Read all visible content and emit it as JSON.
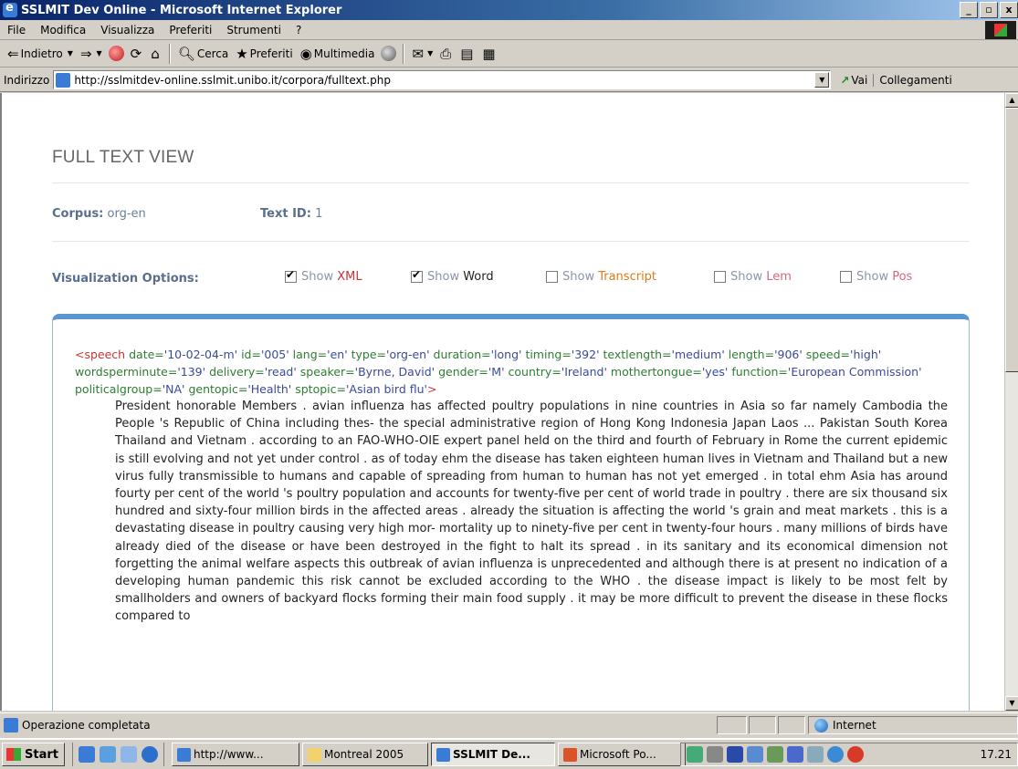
{
  "window": {
    "title": "SSLMIT Dev Online - Microsoft Internet Explorer",
    "min": "_",
    "max": "▫",
    "close": "x"
  },
  "menu": [
    "File",
    "Modifica",
    "Visualizza",
    "Preferiti",
    "Strumenti",
    "?"
  ],
  "toolbar": {
    "back": "Indietro",
    "search": "Cerca",
    "favorites": "Preferiti",
    "media": "Multimedia"
  },
  "address": {
    "label": "Indirizzo",
    "url": "http://sslmitdev-online.sslmit.unibo.it/corpora/fulltext.php",
    "go": "Vai",
    "links": "Collegamenti"
  },
  "page": {
    "title": "FULL TEXT VIEW",
    "corpus_label": "Corpus:",
    "corpus_value": "org-en",
    "textid_label": "Text ID:",
    "textid_value": "1",
    "vis_label": "Visualization Options:",
    "options": [
      {
        "prefix": "Show",
        "name": "XML",
        "checked": true,
        "color": "#cc3333"
      },
      {
        "prefix": "Show",
        "name": "Word",
        "checked": true,
        "color": "#222222"
      },
      {
        "prefix": "Show",
        "name": "Transcript",
        "checked": false,
        "color": "#e07a1a"
      },
      {
        "prefix": "Show",
        "name": "Lem",
        "checked": false,
        "color": "#d9667a"
      },
      {
        "prefix": "Show",
        "name": "Pos",
        "checked": false,
        "color": "#d9667a"
      }
    ],
    "xml_open": "<speech",
    "xml_attrs": [
      [
        "date",
        "'10-02-04-m'"
      ],
      [
        "id",
        "'005'"
      ],
      [
        "lang",
        "'en'"
      ],
      [
        "type",
        "'org-en'"
      ],
      [
        "duration",
        "'long'"
      ],
      [
        "timing",
        "'392'"
      ],
      [
        "textlength",
        "'medium'"
      ],
      [
        "length",
        "'906'"
      ],
      [
        "speed",
        "'high'"
      ],
      [
        "wordsperminute",
        "'139'"
      ],
      [
        "delivery",
        "'read'"
      ],
      [
        "speaker",
        "'Byrne, David'"
      ],
      [
        "gender",
        "'M'"
      ],
      [
        "country",
        "'Ireland'"
      ],
      [
        "mothertongue",
        "'yes'"
      ],
      [
        "function",
        "'European Commission'"
      ],
      [
        "politicalgroup",
        "'NA'"
      ],
      [
        "gentopic",
        "'Health'"
      ],
      [
        "sptopic",
        "'Asian bird flu'"
      ]
    ],
    "xml_close": ">",
    "text": "President honorable Members . avian influenza has affected poultry populations in nine countries in Asia so far namely Cambodia the People 's Republic of China including thes- the special administrative region of Hong Kong Indonesia Japan Laos ... Pakistan South Korea Thailand and Vietnam . according to an FAO-WHO-OIE expert panel held on the third and fourth of February in Rome the current epidemic is still evolving and not yet under control . as of today ehm the disease has taken eighteen human lives in Vietnam and Thailand but a new virus fully transmissible to humans and capable of spreading from human to human has not yet emerged . in total ehm Asia has around fourty per cent of the world 's poultry population and accounts for twenty-five per cent of world trade in poultry . there are six thousand six hundred and sixty-four million birds in the affected areas . already the situation is affecting the world 's grain and meat markets . this is a devastating disease in poultry causing very high mor- mortality up to ninety-five per cent in twenty-four hours . many millions of birds have already died of the disease or have been destroyed in the fight to halt its spread . in its sanitary and its economical dimension not forgetting the animal welfare aspects this outbreak of avian influenza is unprecedented and although there is at present no indication of a developing human pandemic this risk cannot be excluded according to the WHO . the disease impact is likely to be most felt by smallholders and owners of backyard flocks forming their main food supply . it may be more difficult to prevent the disease in these flocks compared to"
  },
  "status": {
    "text": "Operazione completata",
    "zone": "Internet"
  },
  "taskbar": {
    "start": "Start",
    "buttons": [
      "http://www...",
      "Montreal 2005",
      "SSLMIT De...",
      "Microsoft Po..."
    ],
    "clock": "17.21"
  },
  "colors": {
    "accent": "#5b95d4",
    "xml_tag": "#cc3333",
    "xml_attr": "#2e7d32",
    "xml_value": "#3a4a9a",
    "label": "#596f8c"
  }
}
